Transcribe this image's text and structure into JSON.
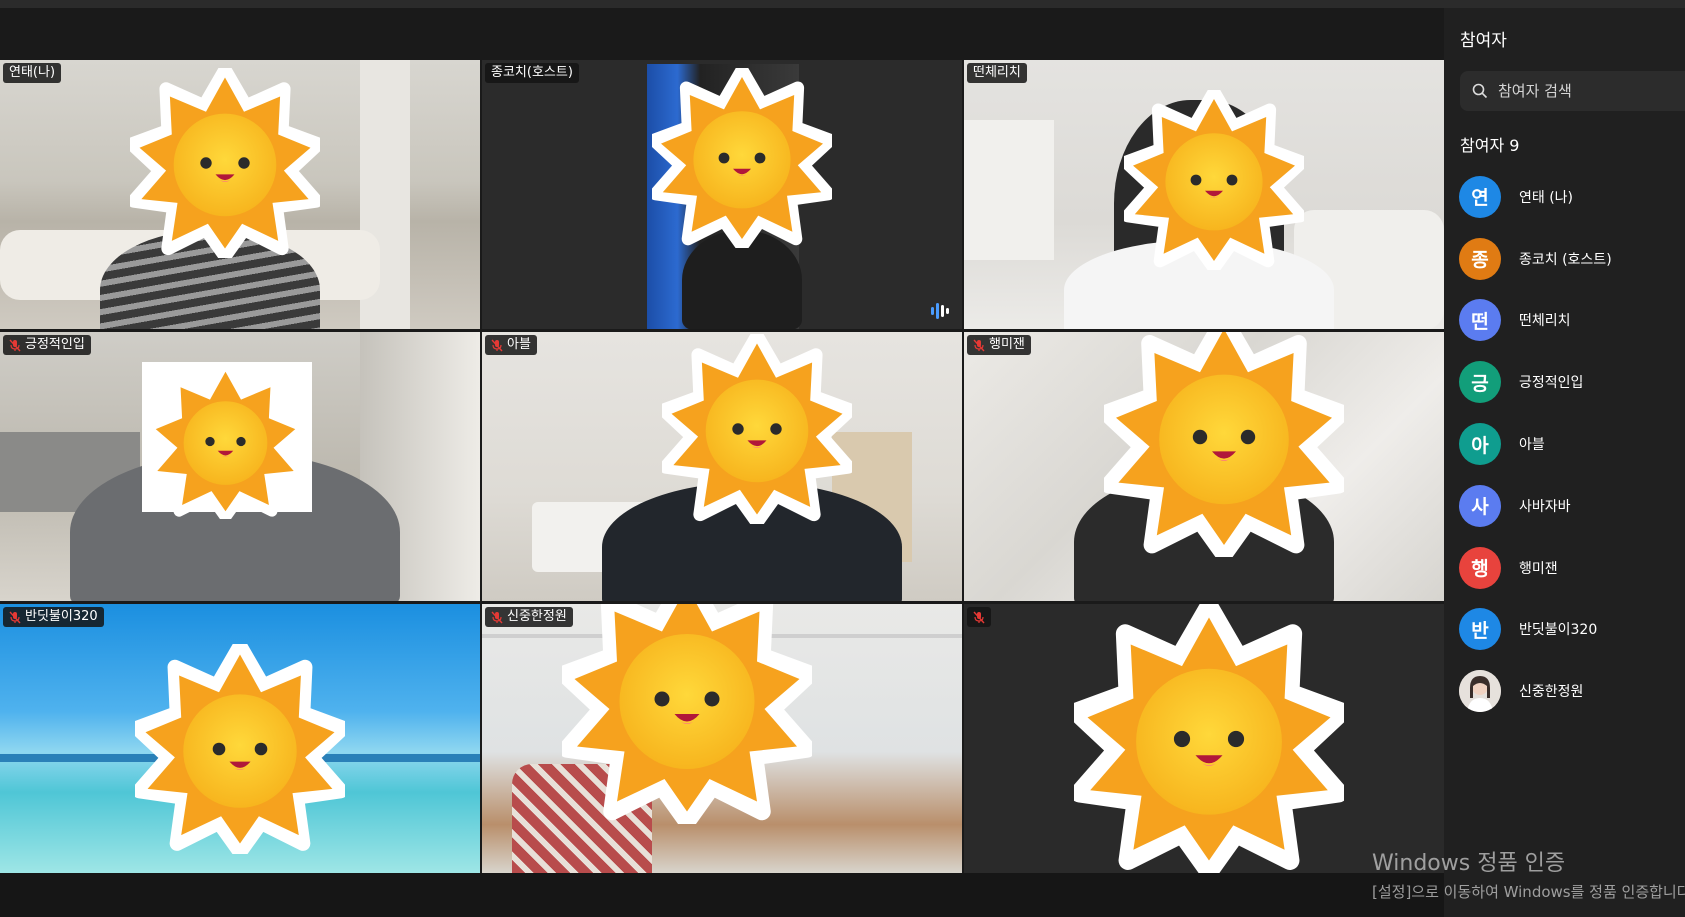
{
  "tiles": [
    {
      "name": "연태(나)",
      "muted": false,
      "active": false
    },
    {
      "name": "종코치(호스트)",
      "muted": false,
      "active": true,
      "speaking": true
    },
    {
      "name": "떤체리치",
      "muted": false,
      "active": false
    },
    {
      "name": "긍정적인입",
      "muted": true,
      "active": false
    },
    {
      "name": "아블",
      "muted": true,
      "active": false
    },
    {
      "name": "행미잰",
      "muted": true,
      "active": false
    },
    {
      "name": "반딧불이320",
      "muted": true,
      "active": false
    },
    {
      "name": "신중한정원",
      "muted": true,
      "active": false
    },
    {
      "name": "",
      "muted": true,
      "active": false
    }
  ],
  "sidebar": {
    "title": "참여자",
    "search_placeholder": "참여자 검색",
    "count_label": "참여자 9",
    "participants": [
      {
        "initial": "연",
        "name": "연태 (나)",
        "color": "#1e88e5"
      },
      {
        "initial": "종",
        "name": "종코치 (호스트)",
        "color": "#e07b13"
      },
      {
        "initial": "떤",
        "name": "떤체리치",
        "color": "#5b7cf0"
      },
      {
        "initial": "긍",
        "name": "긍정적인입",
        "color": "#129e7a"
      },
      {
        "initial": "아",
        "name": "아블",
        "color": "#0f9d8f"
      },
      {
        "initial": "사",
        "name": "사바자바",
        "color": "#5b7cf0"
      },
      {
        "initial": "행",
        "name": "행미잰",
        "color": "#e8433d"
      },
      {
        "initial": "반",
        "name": "반딧불이320",
        "color": "#1e88e5"
      },
      {
        "initial": "",
        "name": "신중한정원",
        "color": "#d8d0c8"
      }
    ]
  },
  "watermark": {
    "line1": "Windows 정품 인증",
    "line2": "[설정]으로 이동하여 Windows를 정품 인증합니다."
  }
}
